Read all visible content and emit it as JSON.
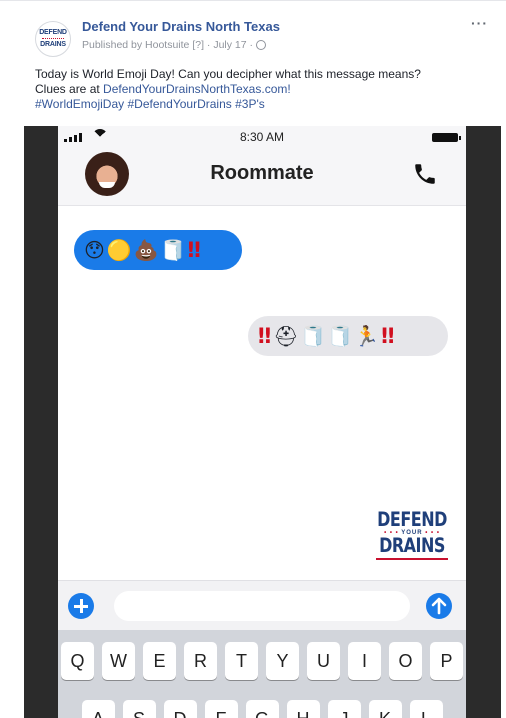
{
  "post": {
    "page_name": "Defend Your Drains North Texas",
    "meta": "Published by Hootsuite [?] · July 17 ·",
    "text_line1": "Today is World Emoji Day! Can you decipher what this message means?",
    "text_clues_prefix": "Clues are at ",
    "text_link": "DefendYourDrainsNorthTexas.com!",
    "hashtags": "#WorldEmojiDay #DefendYourDrains #3P's",
    "more_icon": "···",
    "avatar_line1": "DEFEND",
    "avatar_line2": "DRAINS"
  },
  "phone": {
    "status_time": "8:30 AM",
    "contact_name": "Roommate",
    "bubble_in_emojis": [
      "😯",
      "🟡",
      "💩",
      "🧻"
    ],
    "bubble_in_bang": "‼",
    "bubble_out_bang_start": "‼",
    "bubble_out_emojis": [
      "⛑",
      "🧻",
      "🧻",
      "🏃"
    ],
    "bubble_out_bang_end": "‼",
    "logo": {
      "line1": "DEFEND",
      "line2": "YOUR",
      "line3": "DRAINS"
    },
    "message_placeholder": ""
  },
  "keyboard": {
    "row1": [
      "Q",
      "W",
      "E",
      "R",
      "T",
      "Y",
      "U",
      "I",
      "O",
      "P"
    ],
    "row2": [
      "A",
      "S",
      "D",
      "F",
      "G",
      "H",
      "J",
      "K",
      "L"
    ]
  },
  "colors": {
    "link": "#365899",
    "imessage_blue": "#1a7be8",
    "bubble_gray": "#e6e6ea",
    "brand_navy": "#1f3f7a",
    "brand_red": "#c8102e"
  }
}
